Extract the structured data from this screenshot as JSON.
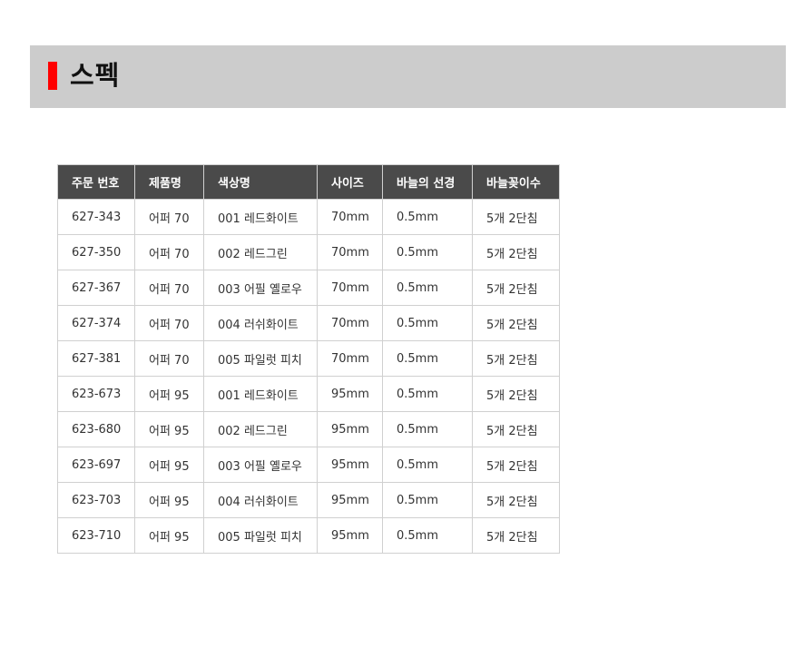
{
  "header": {
    "title": "스펙",
    "accent_color": "#ff0000",
    "bar_color": "#cccccc"
  },
  "table": {
    "header_color": "#4a4a4a",
    "columns": [
      "주문 번호",
      "제품명",
      "색상명",
      "사이즈",
      "바늘의 선경",
      "바늘꽂이수"
    ],
    "rows": [
      [
        "627-343",
        "어퍼 70",
        "001 레드화이트",
        "70mm",
        "0.5mm",
        "5개 2단침"
      ],
      [
        "627-350",
        "어퍼 70",
        "002 레드그린",
        "70mm",
        "0.5mm",
        "5개 2단침"
      ],
      [
        "627-367",
        "어퍼 70",
        "003 어필 옐로우",
        "70mm",
        "0.5mm",
        "5개 2단침"
      ],
      [
        "627-374",
        "어퍼 70",
        "004 러쉬화이트",
        "70mm",
        "0.5mm",
        "5개 2단침"
      ],
      [
        "627-381",
        "어퍼 70",
        "005 파일럿 피치",
        "70mm",
        "0.5mm",
        "5개 2단침"
      ],
      [
        "623-673",
        "어퍼 95",
        "001 레드화이트",
        "95mm",
        "0.5mm",
        "5개 2단침"
      ],
      [
        "623-680",
        "어퍼 95",
        "002 레드그린",
        "95mm",
        "0.5mm",
        "5개 2단침"
      ],
      [
        "623-697",
        "어퍼 95",
        "003 어필 옐로우",
        "95mm",
        "0.5mm",
        "5개 2단침"
      ],
      [
        "623-703",
        "어퍼 95",
        "004 러쉬화이트",
        "95mm",
        "0.5mm",
        "5개 2단침"
      ],
      [
        "623-710",
        "어퍼 95",
        "005 파일럿 피치",
        "95mm",
        "0.5mm",
        "5개 2단침"
      ]
    ]
  }
}
